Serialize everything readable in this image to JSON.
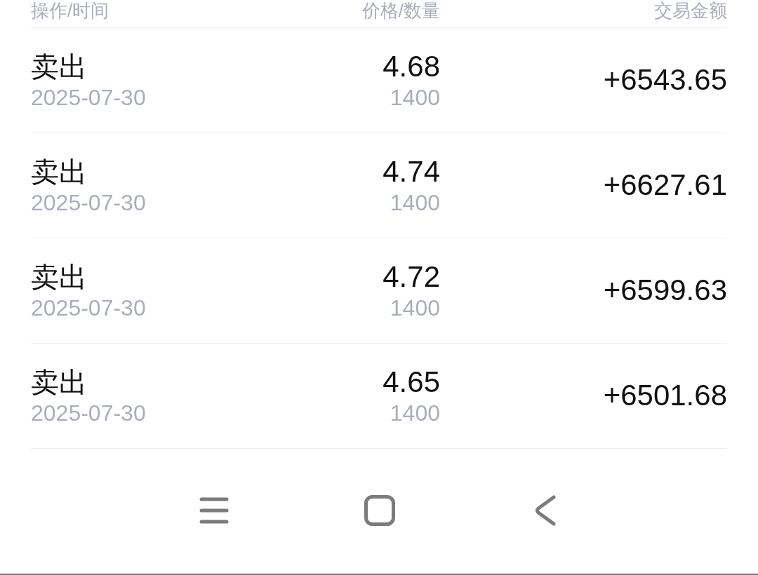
{
  "table": {
    "columns": [
      "操作/时间",
      "价格/数量",
      "交易金额"
    ],
    "rows": [
      {
        "operation": "卖出",
        "date": "2025-07-30",
        "price": "4.68",
        "quantity": "1400",
        "amount": "+6543.65"
      },
      {
        "operation": "卖出",
        "date": "2025-07-30",
        "price": "4.74",
        "quantity": "1400",
        "amount": "+6627.61"
      },
      {
        "operation": "卖出",
        "date": "2025-07-30",
        "price": "4.72",
        "quantity": "1400",
        "amount": "+6599.63"
      },
      {
        "operation": "卖出",
        "date": "2025-07-30",
        "price": "4.65",
        "quantity": "1400",
        "amount": "+6501.68"
      }
    ]
  },
  "nav_bar": {
    "buttons": [
      {
        "kind": "menu"
      },
      {
        "kind": "home"
      },
      {
        "kind": "back"
      }
    ]
  }
}
